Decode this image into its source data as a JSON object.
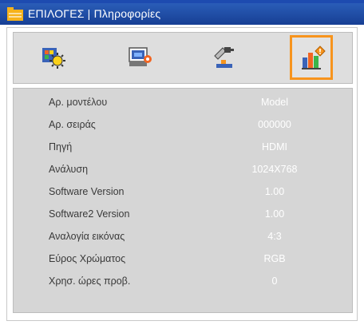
{
  "header": {
    "title": "ΕΠΙΛΟΓΕΣ | Πληροφορίες",
    "icon": "menu-folder-icon"
  },
  "tabs": [
    {
      "name": "image-settings-icon",
      "selected": false
    },
    {
      "name": "display-settings-icon",
      "selected": false
    },
    {
      "name": "setup-settings-icon",
      "selected": false
    },
    {
      "name": "options-info-icon",
      "selected": true
    }
  ],
  "colors": {
    "accent_selected": "#f7941d",
    "title_bar": "#1f4aa8",
    "panel_bg": "#d6d6d6"
  },
  "info_rows": [
    {
      "label": "Αρ. μοντέλου",
      "value": "Model"
    },
    {
      "label": "Αρ. σειράς",
      "value": "000000"
    },
    {
      "label": "Πηγή",
      "value": "HDMI"
    },
    {
      "label": "Ανάλυση",
      "value": "1024X768"
    },
    {
      "label": "Software Version",
      "value": "1.00"
    },
    {
      "label": "Software2 Version",
      "value": "1.00"
    },
    {
      "label": "Αναλογία εικόνας",
      "value": "4:3"
    },
    {
      "label": "Εύρος Χρώματος",
      "value": "RGB"
    },
    {
      "label": "Χρησ. ώρες προβ.",
      "value": "0"
    }
  ]
}
